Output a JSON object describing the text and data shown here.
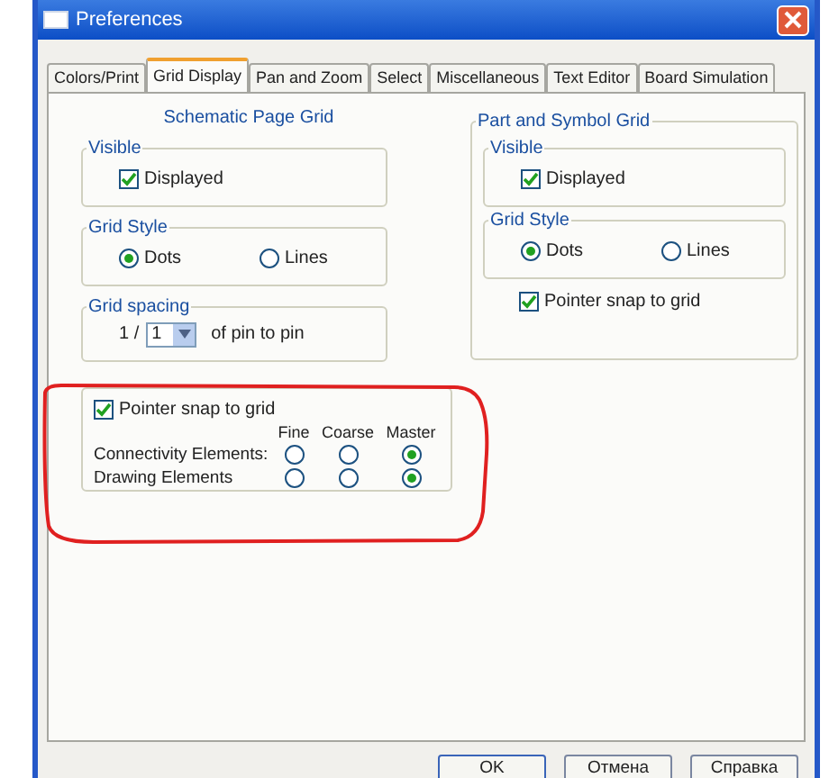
{
  "window": {
    "title": "Preferences"
  },
  "tabs": [
    {
      "label": "Colors/Print",
      "selected": false
    },
    {
      "label": "Grid Display",
      "selected": true
    },
    {
      "label": "Pan and Zoom",
      "selected": false
    },
    {
      "label": "Select",
      "selected": false
    },
    {
      "label": "Miscellaneous",
      "selected": false
    },
    {
      "label": "Text Editor",
      "selected": false
    },
    {
      "label": "Board Simulation",
      "selected": false
    }
  ],
  "schematic_grid": {
    "title": "Schematic Page Grid",
    "visible": {
      "label": "Visible",
      "checkbox": {
        "label": "Displayed",
        "checked": true
      }
    },
    "grid_style": {
      "label": "Grid Style",
      "options": [
        {
          "label": "Dots",
          "selected": true
        },
        {
          "label": "Lines",
          "selected": false
        }
      ]
    },
    "grid_spacing": {
      "label": "Grid spacing",
      "prefix": "1 /",
      "value": "1",
      "suffix": "of pin to pin"
    }
  },
  "snap_group": {
    "checkbox": {
      "label": "Pointer snap to grid",
      "checked": true
    },
    "columns": [
      "Fine",
      "Coarse",
      "Master"
    ],
    "rows": [
      {
        "label": "Connectivity Elements:",
        "options": [
          {
            "selected": false
          },
          {
            "selected": false
          },
          {
            "selected": true
          }
        ]
      },
      {
        "label": "Drawing Elements",
        "options": [
          {
            "selected": false
          },
          {
            "selected": false
          },
          {
            "selected": true
          }
        ]
      }
    ]
  },
  "part_grid": {
    "title": "Part and Symbol Grid",
    "visible": {
      "label": "Visible",
      "checkbox": {
        "label": "Displayed",
        "checked": true
      }
    },
    "grid_style": {
      "label": "Grid Style",
      "options": [
        {
          "label": "Dots",
          "selected": true
        },
        {
          "label": "Lines",
          "selected": false
        }
      ]
    },
    "snap": {
      "label": "Pointer snap to grid",
      "checked": true
    }
  },
  "buttons": [
    "OK",
    "Отмена",
    "Справка"
  ]
}
